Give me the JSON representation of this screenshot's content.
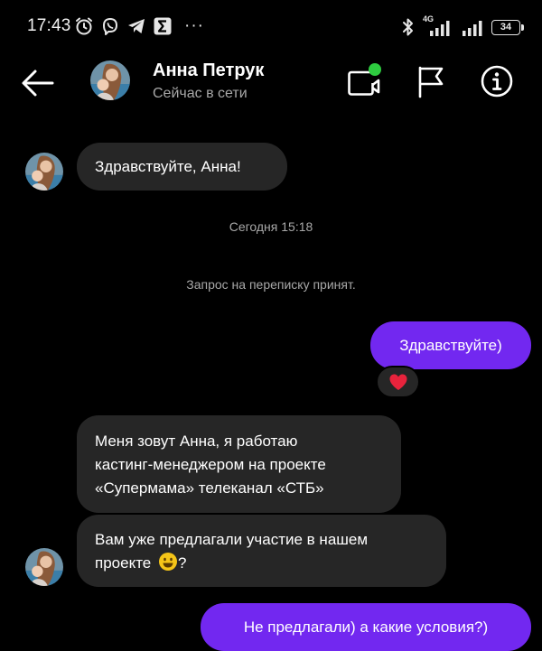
{
  "status_bar": {
    "time": "17:43",
    "network_label": "4G",
    "overflow_dots": "···",
    "battery": "34"
  },
  "header": {
    "contact_name": "Анна Петрук",
    "contact_status": "Сейчас в сети"
  },
  "conversation": {
    "messages": [
      {
        "direction": "incoming",
        "text": "Здравствуйте, Анна!"
      },
      {
        "direction": "system",
        "text": "Сегодня 15:18"
      },
      {
        "direction": "system",
        "text": "Запрос на переписку принят."
      },
      {
        "direction": "outgoing",
        "text": "Здравствуйте)",
        "reaction": "heart-icon"
      },
      {
        "direction": "incoming",
        "lines": [
          "Меня зовут Анна, я работаю",
          "кастинг-менеджером на проекте",
          "«Супермама» телеканал «СТБ»"
        ]
      },
      {
        "direction": "incoming",
        "lines": [
          "Вам уже предлагали участие в нашем",
          "проекте",
          "?"
        ],
        "emoji": "smile-emoji"
      },
      {
        "direction": "outgoing",
        "text": "Не предлагали) а какие условия?)"
      }
    ]
  },
  "colors": {
    "background": "#000000",
    "incoming_bubble": "#262626",
    "outgoing_bubble": "#7228f0",
    "secondary_text": "#a8a8a8",
    "online_dot": "#2ecc40",
    "reaction_heart": "#e8233c"
  }
}
